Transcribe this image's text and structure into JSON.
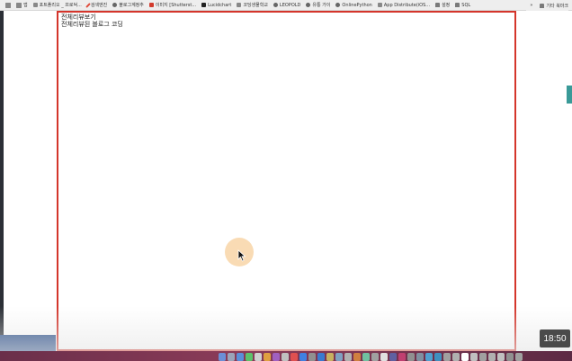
{
  "bookmarks": {
    "items": [
      {
        "label": "",
        "icon": "apps-grid-icon"
      },
      {
        "label": "앱",
        "icon": "apps-icon"
      },
      {
        "label": "포트폴리오 _ 프로덕...",
        "icon": "drive-icon"
      },
      {
        "label": "검색엔진",
        "icon": "pen-icon"
      },
      {
        "label": "블로그계정추",
        "icon": "globe-icon"
      },
      {
        "label": "이미지 [Shutterst...",
        "icon": "red-square-icon"
      },
      {
        "label": "Lucidchart",
        "icon": "lucid-icon"
      },
      {
        "label": "코딩생물학교",
        "icon": "text-icon"
      },
      {
        "label": "LEOPOLD",
        "icon": "globe-icon"
      },
      {
        "label": "유통 가이",
        "icon": "globe-icon"
      },
      {
        "label": "OnlinePython",
        "icon": "github-icon"
      },
      {
        "label": "App Distribute(iOS...",
        "icon": "vector-icon"
      },
      {
        "label": "설정",
        "icon": "folder-icon"
      },
      {
        "label": "SQL",
        "icon": "folder-icon"
      }
    ],
    "overflow": "»",
    "other_label": "기타 북마크"
  },
  "content": {
    "line1": "전체리뷰보기",
    "line2": "전체리뷰된 블로그 코딩"
  },
  "time_badge": "18:50",
  "colors": {
    "frame": "#d4352b",
    "right_tab": "#3a9a98",
    "dock": "#7d3552",
    "time_badge_bg": "#4a4a4a"
  },
  "dock_icons": [
    {
      "name": "finder-icon",
      "color": "#6b8fd6"
    },
    {
      "name": "launchpad-icon",
      "color": "#9aa4b8"
    },
    {
      "name": "safari-icon",
      "color": "#5a8fd8"
    },
    {
      "name": "messages-icon",
      "color": "#5cc26a"
    },
    {
      "name": "app-icon",
      "color": "#d0d0d0"
    },
    {
      "name": "app-icon",
      "color": "#e0a040"
    },
    {
      "name": "app-icon",
      "color": "#a060c0"
    },
    {
      "name": "app-icon",
      "color": "#c0c0c0"
    },
    {
      "name": "app-icon",
      "color": "#e05050"
    },
    {
      "name": "app-icon",
      "color": "#4080e0"
    },
    {
      "name": "app-icon",
      "color": "#909090"
    },
    {
      "name": "vscode-icon",
      "color": "#3a7ad0"
    },
    {
      "name": "app-icon",
      "color": "#c8b060"
    },
    {
      "name": "app-icon",
      "color": "#80a0c0"
    },
    {
      "name": "app-icon",
      "color": "#b0b0b0"
    },
    {
      "name": "app-icon",
      "color": "#d08040"
    },
    {
      "name": "app-icon",
      "color": "#70c0a0"
    },
    {
      "name": "app-icon",
      "color": "#a0a0a0"
    },
    {
      "name": "app-icon",
      "color": "#e0e0e0"
    },
    {
      "name": "app-icon",
      "color": "#6060a0"
    },
    {
      "name": "app-icon",
      "color": "#c04070"
    },
    {
      "name": "app-icon",
      "color": "#909090"
    },
    {
      "name": "app-icon",
      "color": "#8090a0"
    },
    {
      "name": "app-icon",
      "color": "#50a0d0"
    },
    {
      "name": "app-icon",
      "color": "#4090c0"
    },
    {
      "name": "app-icon",
      "color": "#a0a0a0"
    },
    {
      "name": "app-icon",
      "color": "#b0b0b0"
    },
    {
      "name": "notion-icon",
      "color": "#ffffff"
    },
    {
      "name": "app-icon",
      "color": "#c0c0c0"
    },
    {
      "name": "app-icon",
      "color": "#a0a0a0"
    },
    {
      "name": "app-icon",
      "color": "#b0b0b0"
    },
    {
      "name": "app-icon",
      "color": "#c0c0c0"
    },
    {
      "name": "app-icon",
      "color": "#909090"
    },
    {
      "name": "trash-icon",
      "color": "#a0a0a0"
    }
  ]
}
